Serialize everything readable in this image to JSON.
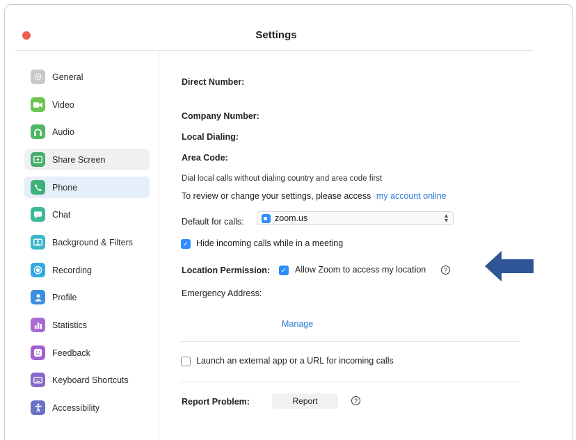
{
  "window": {
    "title": "Settings"
  },
  "sidebar": {
    "items": [
      {
        "label": "General",
        "icon": "gear-icon",
        "color": "#c8c8c8"
      },
      {
        "label": "Video",
        "icon": "video-camera-icon",
        "color": "#6cc34f"
      },
      {
        "label": "Audio",
        "icon": "headphones-icon",
        "color": "#4fb765"
      },
      {
        "label": "Share Screen",
        "icon": "share-screen-icon",
        "color": "#45ad6a"
      },
      {
        "label": "Phone",
        "icon": "phone-icon",
        "color": "#3eb07c"
      },
      {
        "label": "Chat",
        "icon": "chat-bubble-icon",
        "color": "#3fb89a"
      },
      {
        "label": "Background & Filters",
        "icon": "background-person-icon",
        "color": "#3ab6c9"
      },
      {
        "label": "Recording",
        "icon": "record-icon",
        "color": "#35a9e0"
      },
      {
        "label": "Profile",
        "icon": "profile-icon",
        "color": "#3c8ee0"
      },
      {
        "label": "Statistics",
        "icon": "bar-chart-icon",
        "color": "#a86bd6"
      },
      {
        "label": "Feedback",
        "icon": "smiley-icon",
        "color": "#a160cf"
      },
      {
        "label": "Keyboard Shortcuts",
        "icon": "keyboard-icon",
        "color": "#8669c9"
      },
      {
        "label": "Accessibility",
        "icon": "accessibility-icon",
        "color": "#6a72c8"
      }
    ],
    "active_index": 4,
    "hover_index": 3
  },
  "phone": {
    "direct_number_label": "Direct Number:",
    "company_number_label": "Company Number:",
    "local_dialing_label": "Local Dialing:",
    "area_code_label": "Area Code:",
    "dial_local_note": "Dial local calls without dialing country and area code first",
    "review_text": "To review or change your settings, please access",
    "account_link": "my account online",
    "default_calls_label": "Default for calls:",
    "default_calls_value": "zoom.us",
    "hide_incoming_label": "Hide incoming calls while in a meeting",
    "hide_incoming_checked": true,
    "location_permission_label": "Location Permission:",
    "allow_location_label": "Allow Zoom to access my location",
    "allow_location_checked": true,
    "emergency_address_label": "Emergency Address:",
    "manage_link": "Manage",
    "launch_external_label": "Launch an external app or a URL for incoming calls",
    "launch_external_checked": false,
    "report_problem_label": "Report Problem:",
    "report_button": "Report"
  },
  "colors": {
    "accent": "#2d8cff",
    "link": "#2d7bd6",
    "arrow": "#2f5597",
    "close": "#ee5b52"
  }
}
